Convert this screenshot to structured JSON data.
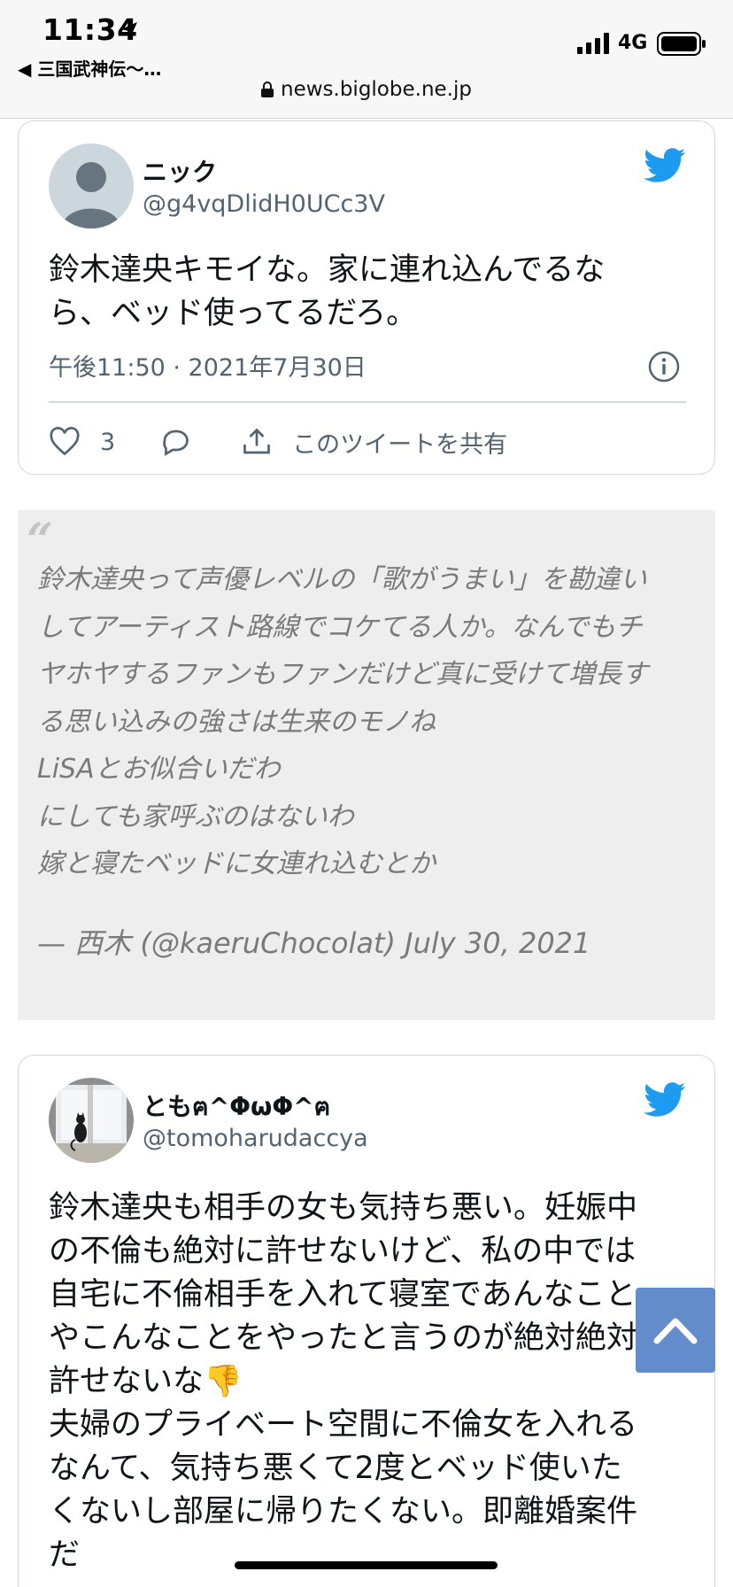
{
  "status": {
    "time": "11:34",
    "network": "4G",
    "back_app": "◀ 三国武神伝〜…"
  },
  "browser": {
    "url": "news.biglobe.ne.jp"
  },
  "colors": {
    "twitter_blue": "#1d9bf0",
    "scroll_button": "#5b86c9"
  },
  "tweet1": {
    "name": "ニック",
    "handle": "@g4vqDlidH0UCc3V",
    "text_lines": [
      "鈴木達央キモイな。家に連れ込んでるな",
      "ら、ベッド使ってるだろ。"
    ],
    "timestamp": "午後11:50 · 2021年7月30日",
    "like_count": "3",
    "share_label": "このツイートを共有",
    "avatar_icon": "default-profile-icon"
  },
  "quote": {
    "lines": [
      "鈴木達央って声優レベルの「歌がうまい」を勘違い",
      "してアーティスト路線でコケてる人か。なんでもチ",
      "ヤホヤするファンもファンだけど真に受けて増長す",
      "る思い込みの強さは生来のモノね",
      "LiSAとお似合いだわ",
      "にしても家呼ぶのはないわ",
      "嫁と寝たベッドに女連れ込むとか"
    ],
    "attribution": "— 西木 (@kaeruChocolat) July 30, 2021"
  },
  "tweet2": {
    "name": "ともฅ^ΦωΦ^ฅ",
    "handle": "@tomoharudaccya",
    "text_lines": [
      "鈴木達央も相手の女も気持ち悪い。妊娠中",
      "の不倫も絶対に許せないけど、私の中では",
      "自宅に不倫相手を入れて寝室であんなこと",
      "やこんなことをやったと言うのが絶対絶対",
      "許せないな👎",
      "夫婦のプライベート空間に不倫女を入れる",
      "なんて、気持ち悪くて2度とベッド使いた",
      "くないし部屋に帰りたくない。即離婚案件",
      "だ"
    ],
    "avatar_icon": "cat-window-photo"
  }
}
